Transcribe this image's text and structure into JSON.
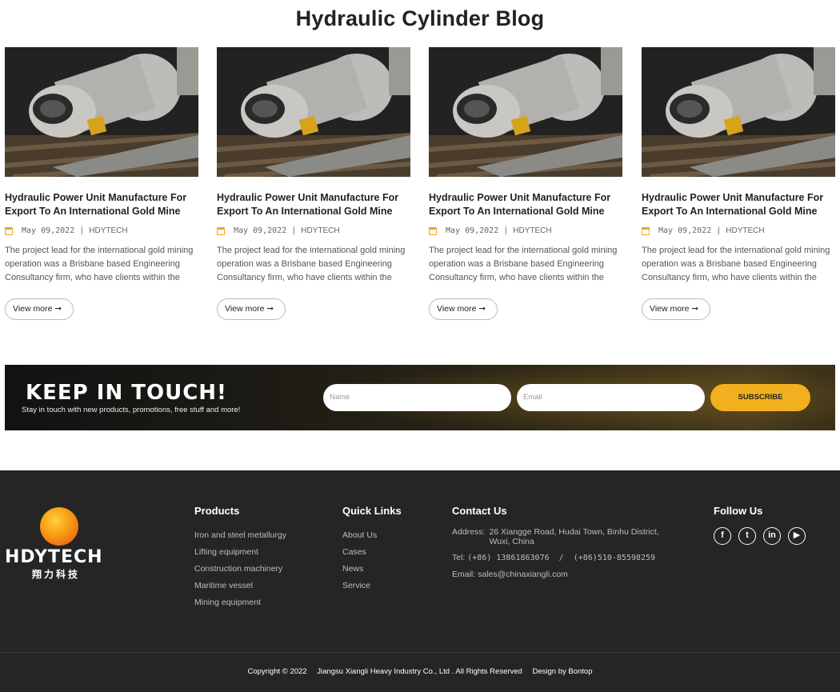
{
  "page_title": "Hydraulic Cylinder Blog",
  "posts": [
    {
      "title": "Hydraulic Power Unit Manufacture For Export To An International Gold Mine",
      "date": "May 09,2022",
      "separator": "|",
      "author": "HDYTECH",
      "excerpt": "The project lead for the international gold mining operation was a Brisbane based Engineering Consultancy firm, who have clients within the global miner-",
      "button": "View more"
    },
    {
      "title": "Hydraulic Power Unit Manufacture For Export To An International Gold Mine",
      "date": "May 09,2022",
      "separator": "|",
      "author": "HDYTECH",
      "excerpt": "The project lead for the international gold mining operation was a Brisbane based Engineering Consultancy firm, who have clients within the global miner-",
      "button": "View more"
    },
    {
      "title": "Hydraulic Power Unit Manufacture For Export To An International Gold Mine",
      "date": "May 09,2022",
      "separator": "|",
      "author": "HDYTECH",
      "excerpt": "The project lead for the international gold mining operation was a Brisbane based Engineering Consultancy firm, who have clients within the global miner-",
      "button": "View more"
    },
    {
      "title": "Hydraulic Power Unit Manufacture For Export To An International Gold Mine",
      "date": "May 09,2022",
      "separator": "|",
      "author": "HDYTECH",
      "excerpt": "The project lead for the international gold mining operation was a Brisbane based Engineering Consultancy firm, who have clients within the global miner-",
      "button": "View more"
    }
  ],
  "newsletter": {
    "heading": "KEEP IN TOUCH!",
    "subheading": "Stay in touch with new products, promotions, free stuff and more!",
    "name_placeholder": "Name",
    "email_placeholder": "Email",
    "subscribe_label": "SUBSCRIBE"
  },
  "footer": {
    "logo_text": "HDYTECH",
    "logo_cn": "翔力科技",
    "products": {
      "heading": "Products",
      "items": [
        "Iron and steel metallurgy",
        "Lifting equipment",
        "Construction machinery",
        "Maritime vessel",
        "Mining equipment"
      ]
    },
    "quick_links": {
      "heading": "Quick Links",
      "items": [
        "About Us",
        "Cases",
        "News",
        "Service"
      ]
    },
    "contact": {
      "heading": "Contact Us",
      "address_label": "Address:",
      "address_line1": "26 Xiangge Road, Hudai Town, Binhu District,",
      "address_line2": "Wuxi, China",
      "tel_label": "Tel:",
      "tel_value": "(+86) 13861863076  /  (+86)510-85598259",
      "email_label": "Email:",
      "email_value": "sales@chinaxiangli.com"
    },
    "follow": {
      "heading": "Follow Us",
      "icons": [
        "facebook-icon",
        "twitter-icon",
        "linkedin-icon",
        "youtube-icon"
      ]
    },
    "copyright": {
      "prefix": "Copyright ©",
      "year": "2022",
      "company": "Jiangsu Xiangli Heavy Industry Co., Ltd . All Rights Reserved",
      "design": "Design by Bontop"
    }
  }
}
